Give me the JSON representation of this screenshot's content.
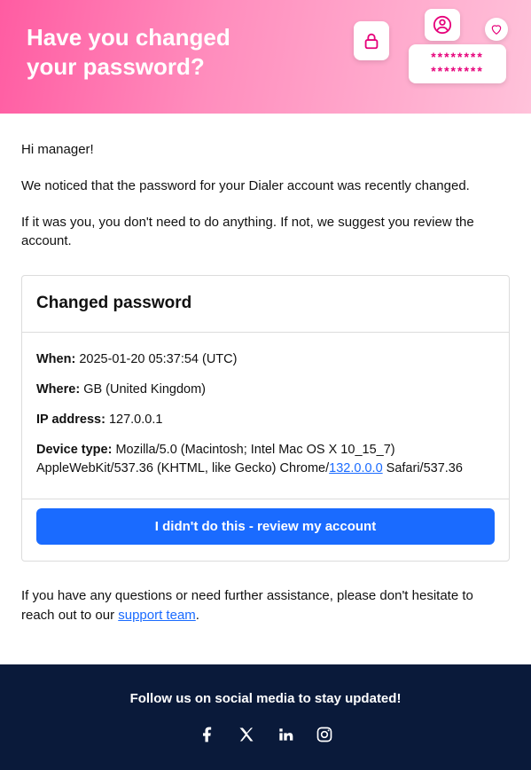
{
  "header": {
    "title_line1": "Have you changed",
    "title_line2": "your password?",
    "asterisks": "********"
  },
  "body": {
    "greeting": "Hi manager!",
    "intro": "We noticed that the password for your Dialer account was recently changed.",
    "advice": "If it was you, you don't need to do anything. If not, we suggest you review the account."
  },
  "box": {
    "title": "Changed password",
    "when_label": "When:",
    "when_value": "2025-01-20 05:37:54 (UTC)",
    "where_label": "Where:",
    "where_value": "GB (United Kingdom)",
    "ip_label": "IP address:",
    "ip_value": "127.0.0.1",
    "device_label": "Device type:",
    "device_prefix": "Mozilla/5.0 (Macintosh; Intel Mac OS X 10_15_7) AppleWebKit/537.36 (KHTML, like Gecko) Chrome/",
    "device_version_link": "132.0.0.0",
    "device_suffix": " Safari/537.36",
    "button_label": "I didn't do this - review my account"
  },
  "closing": {
    "prefix": "If you have any questions or need further assistance, please don't hesitate to reach out to our ",
    "link_text": "support team",
    "suffix": "."
  },
  "footer": {
    "title": "Follow us on social media to stay updated!"
  }
}
